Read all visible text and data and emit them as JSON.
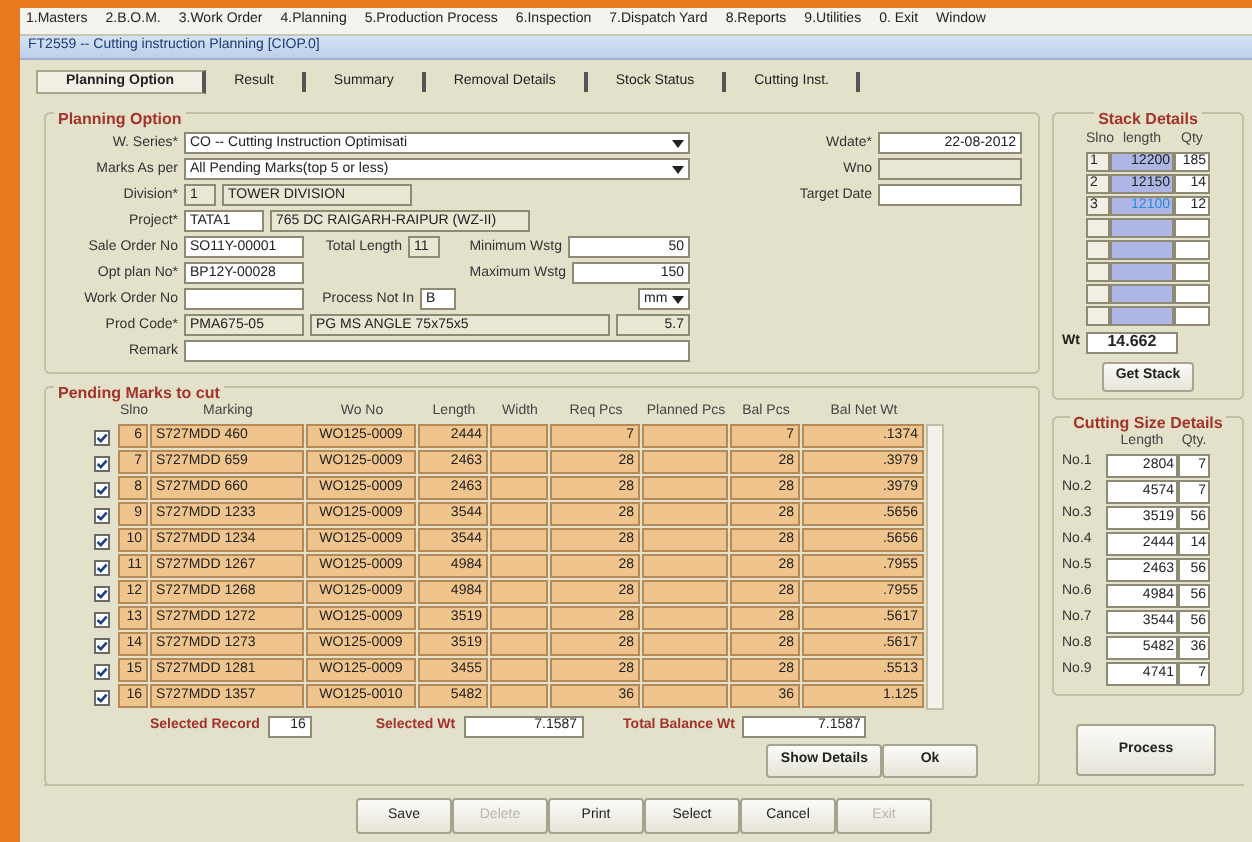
{
  "menu": [
    "1.Masters",
    "2.B.O.M.",
    "3.Work Order",
    "4.Planning",
    "5.Production Process",
    "6.Inspection",
    "7.Dispatch Yard",
    "8.Reports",
    "9.Utilities",
    "0. Exit",
    "Window"
  ],
  "window": {
    "title": "FT2559 -- Cutting instruction Planning [CIOP.0]"
  },
  "tabs": [
    {
      "label": "Planning Option",
      "selected": true
    },
    {
      "label": "Result",
      "selected": false
    },
    {
      "label": "Summary",
      "selected": false
    },
    {
      "label": "Removal Details",
      "selected": false
    },
    {
      "label": "Stock Status",
      "selected": false
    },
    {
      "label": "Cutting Inst.",
      "selected": false
    }
  ],
  "planning_option": {
    "legend": "Planning Option",
    "rows": [
      [
        {
          "kind": "label",
          "text": "W. Series*"
        },
        {
          "kind": "select",
          "value": "CO  --  Cutting Instruction Optimisati"
        }
      ],
      [
        {
          "kind": "label",
          "text": "Marks As per"
        },
        {
          "kind": "select",
          "value": "All Pending Marks(top 5 or less)"
        }
      ],
      [
        {
          "kind": "label",
          "text": "Division*"
        },
        {
          "kind": "field",
          "value": "1",
          "disabled": true
        },
        {
          "kind": "field",
          "value": "TOWER DIVISION",
          "disabled": true
        }
      ],
      [
        {
          "kind": "label",
          "text": "Project*"
        },
        {
          "kind": "field",
          "value": "TATA1",
          "disabled": false
        },
        {
          "kind": "field",
          "value": "765 DC RAIGARH-RAIPUR (WZ-II)",
          "disabled": true
        }
      ],
      [
        {
          "kind": "label",
          "text": "Sale Order No"
        },
        {
          "kind": "field",
          "value": "SO11Y-00001",
          "disabled": false
        },
        {
          "kind": "label",
          "text": "Total Length"
        },
        {
          "kind": "field",
          "value": "11",
          "disabled": true
        },
        {
          "kind": "label",
          "text": "Minimum Wstg"
        },
        {
          "kind": "field",
          "value": "50",
          "disabled": false
        }
      ],
      [
        {
          "kind": "label",
          "text": "Opt plan No*"
        },
        {
          "kind": "field",
          "value": "BP12Y-00028",
          "disabled": false
        },
        {
          "kind": "label",
          "text": "Maximum Wstg"
        },
        {
          "kind": "field",
          "value": "150",
          "disabled": false
        }
      ],
      [
        {
          "kind": "label",
          "text": "Work Order No"
        },
        {
          "kind": "field",
          "disabled": false
        },
        {
          "kind": "label",
          "text": "Process Not In"
        },
        {
          "kind": "field",
          "value": "B",
          "disabled": false
        },
        {
          "kind": "select",
          "value": "mm"
        }
      ],
      [
        {
          "kind": "label",
          "text": "Prod Code*"
        },
        {
          "kind": "field",
          "value": "PMA675-05",
          "disabled": true
        },
        {
          "kind": "field",
          "value": "PG MS ANGLE 75x75x5",
          "disabled": true
        },
        {
          "kind": "field",
          "value": "5.7",
          "disabled": true
        }
      ],
      [
        {
          "kind": "label",
          "text": "Remark"
        },
        {
          "kind": "field",
          "disabled": false
        }
      ]
    ],
    "side_rows": [
      {
        "label": "Wdate*",
        "value": "22-08-2012",
        "disabled": false
      },
      {
        "label": "Wno",
        "disabled": true
      },
      {
        "label": "Target Date",
        "disabled": false
      }
    ]
  },
  "pending_marks": {
    "legend": "Pending Marks to cut",
    "columns": [
      "Slno",
      "Marking",
      "Wo No",
      "Length",
      "Width",
      "Req Pcs",
      "Planned Pcs",
      "Bal Pcs",
      "Bal Net Wt"
    ],
    "rows": [
      {
        "checked": true,
        "slno": "6",
        "marking": "S727MDD 460",
        "wo_no": "WO125-0009",
        "length": "2444",
        "req_pcs": "7",
        "bal_pcs": "7",
        "bal_net_wt": ".1374"
      },
      {
        "checked": true,
        "slno": "7",
        "marking": "S727MDD 659",
        "wo_no": "WO125-0009",
        "length": "2463",
        "req_pcs": "28",
        "bal_pcs": "28",
        "bal_net_wt": ".3979"
      },
      {
        "checked": true,
        "slno": "8",
        "marking": "S727MDD 660",
        "wo_no": "WO125-0009",
        "length": "2463",
        "req_pcs": "28",
        "bal_pcs": "28",
        "bal_net_wt": ".3979"
      },
      {
        "checked": true,
        "slno": "9",
        "marking": "S727MDD 1233",
        "wo_no": "WO125-0009",
        "length": "3544",
        "req_pcs": "28",
        "bal_pcs": "28",
        "bal_net_wt": ".5656"
      },
      {
        "checked": true,
        "slno": "10",
        "marking": "S727MDD 1234",
        "wo_no": "WO125-0009",
        "length": "3544",
        "req_pcs": "28",
        "bal_pcs": "28",
        "bal_net_wt": ".5656"
      },
      {
        "checked": true,
        "slno": "11",
        "marking": "S727MDD 1267",
        "wo_no": "WO125-0009",
        "length": "4984",
        "req_pcs": "28",
        "bal_pcs": "28",
        "bal_net_wt": ".7955"
      },
      {
        "checked": true,
        "slno": "12",
        "marking": "S727MDD 1268",
        "wo_no": "WO125-0009",
        "length": "4984",
        "req_pcs": "28",
        "bal_pcs": "28",
        "bal_net_wt": ".7955"
      },
      {
        "checked": true,
        "slno": "13",
        "marking": "S727MDD 1272",
        "wo_no": "WO125-0009",
        "length": "3519",
        "req_pcs": "28",
        "bal_pcs": "28",
        "bal_net_wt": ".5617"
      },
      {
        "checked": true,
        "slno": "14",
        "marking": "S727MDD 1273",
        "wo_no": "WO125-0009",
        "length": "3519",
        "req_pcs": "28",
        "bal_pcs": "28",
        "bal_net_wt": ".5617"
      },
      {
        "checked": true,
        "slno": "15",
        "marking": "S727MDD 1281",
        "wo_no": "WO125-0009",
        "length": "3455",
        "req_pcs": "28",
        "bal_pcs": "28",
        "bal_net_wt": ".5513"
      },
      {
        "checked": true,
        "slno": "16",
        "marking": "S727MDD 1357",
        "wo_no": "WO125-0010",
        "length": "5482",
        "req_pcs": "36",
        "bal_pcs": "36",
        "bal_net_wt": "1.125"
      }
    ],
    "summary": [
      {
        "label": "Selected Record",
        "value": "16"
      },
      {
        "label": "Selected Wt",
        "value": "7.1587"
      },
      {
        "label": "Total Balance Wt",
        "value": "7.1587"
      }
    ],
    "buttons": [
      "Show Details",
      "Ok"
    ]
  },
  "stack_details": {
    "legend": "Stack Details",
    "columns": [
      "Slno",
      "length",
      "Qty"
    ],
    "rows": [
      {
        "slno": "1",
        "length": "12200",
        "qty": "185",
        "selected": false
      },
      {
        "slno": "2",
        "length": "12150",
        "qty": "14",
        "selected": false
      },
      {
        "slno": "3",
        "length": "12100",
        "qty": "12",
        "selected": true
      }
    ],
    "wt_label": "Wt",
    "wt": "14.662",
    "button": "Get Stack"
  },
  "cutting_size_details": {
    "legend": "Cutting Size Details",
    "columns": [
      "Length",
      "Qty."
    ],
    "rows": [
      {
        "label": "No.1",
        "length": "2804",
        "qty": "7"
      },
      {
        "label": "No.2",
        "length": "4574",
        "qty": "7"
      },
      {
        "label": "No.3",
        "length": "3519",
        "qty": "56"
      },
      {
        "label": "No.4",
        "length": "2444",
        "qty": "14"
      },
      {
        "label": "No.5",
        "length": "2463",
        "qty": "56"
      },
      {
        "label": "No.6",
        "length": "4984",
        "qty": "56"
      },
      {
        "label": "No.7",
        "length": "3544",
        "qty": "56"
      },
      {
        "label": "No.8",
        "length": "5482",
        "qty": "36"
      },
      {
        "label": "No.9",
        "length": "4741",
        "qty": "7"
      }
    ]
  },
  "process_button": "Process",
  "buttons": [
    {
      "label": "Save",
      "disabled": false
    },
    {
      "label": "Delete",
      "disabled": true
    },
    {
      "label": "Print",
      "disabled": false
    },
    {
      "label": "Select",
      "disabled": false
    },
    {
      "label": "Cancel",
      "disabled": false
    },
    {
      "label": "Exit",
      "disabled": true
    }
  ]
}
